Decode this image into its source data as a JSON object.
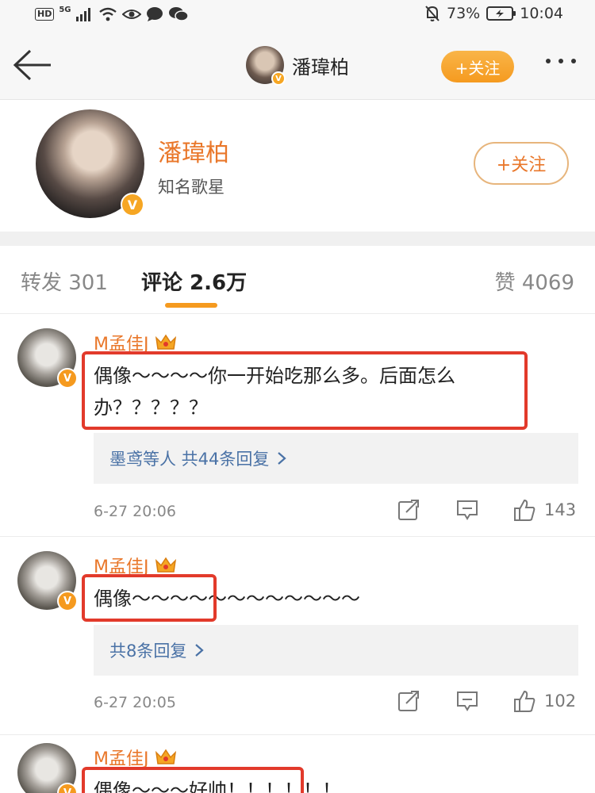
{
  "status_bar": {
    "network_badge": "HD",
    "network_type": "5G",
    "battery_percent": "73%",
    "time": "10:04"
  },
  "nav": {
    "title": "潘瑋柏",
    "follow_label": "+关注"
  },
  "profile": {
    "name": "潘瑋柏",
    "bio": "知名歌星",
    "follow_label": "+关注"
  },
  "tabs": {
    "repost": "转发 301",
    "comments": "评论 2.6万",
    "likes": "赞 4069"
  },
  "comments": [
    {
      "user": "M孟佳J",
      "text": "偶像～～～～你一开始吃那么多。后面怎么办？？？？？",
      "replies": "墨鸢等人  共44条回复",
      "time": "6-27 20:06",
      "likes": "143"
    },
    {
      "user": "M孟佳J",
      "text": "偶像～～～～～～～～～～～～",
      "replies": "共8条回复",
      "time": "6-27 20:05",
      "likes": "102"
    },
    {
      "user": "M孟佳J",
      "text": "偶像～～～好帅！！！！！！"
    }
  ],
  "colors": {
    "accent_orange": "#f59a1f",
    "username_orange": "#e9772a",
    "link_blue": "#4a72a6",
    "highlight_red": "#e23a2b"
  },
  "icons": {
    "back": "arrow-left-icon",
    "more": "more-dots-icon",
    "verified": "verified-v-icon",
    "vip": "crown-icon",
    "repost": "share-icon",
    "comment": "comment-icon",
    "like": "thumb-up-icon"
  }
}
